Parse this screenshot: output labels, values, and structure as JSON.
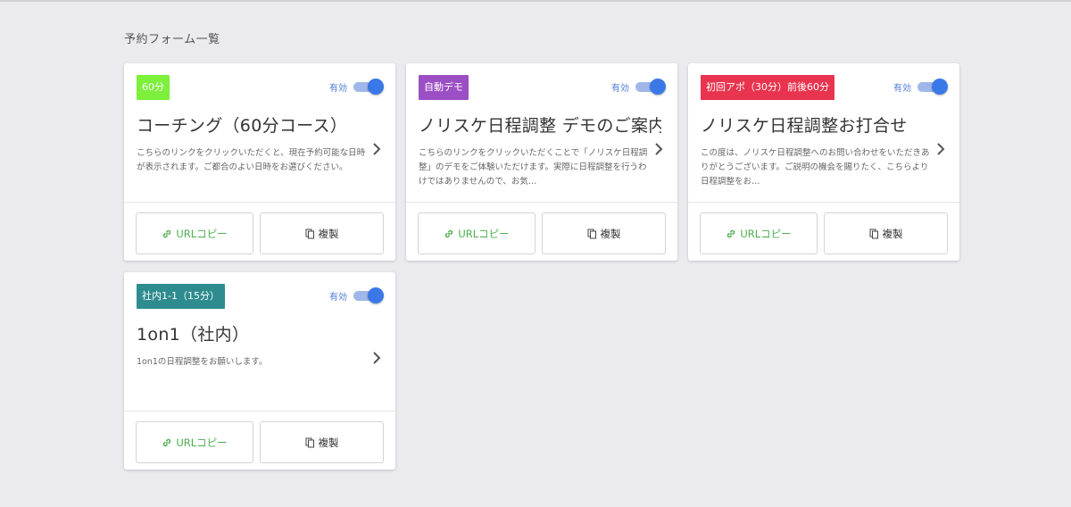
{
  "page": {
    "title": "予約フォーム一覧"
  },
  "common": {
    "toggle_label": "有効",
    "url_copy_label": "URLコピー",
    "duplicate_label": "複製",
    "url_color": "#4caf50",
    "toggle_color": "#3b78e7"
  },
  "cards": [
    {
      "badge": "60分",
      "badge_color": "#7cf03a",
      "title": "コーチング（60分コース）",
      "description": "こちらのリンクをクリックいただくと、現在予約可能な日時が表示されます。ご都合のよい日時をお選びください。",
      "enabled": true
    },
    {
      "badge": "自動デモ",
      "badge_color": "#9b4fc4",
      "title": "ノリスケ日程調整 デモのご案内",
      "description": "こちらのリンクをクリックいただくことで「ノリスケ日程調整」のデモをご体験いただけます。実際に日程調整を行うわけではありませんので、お気…",
      "enabled": true
    },
    {
      "badge": "初回アポ（30分）前後60分",
      "badge_color": "#e8344e",
      "title": "ノリスケ日程調整お打合せ",
      "description": "この度は、ノリスケ日程調整へのお問い合わせをいただきありがとうございます。ご説明の機会を賜りたく、こちらより日程調整をお…",
      "enabled": true
    },
    {
      "badge": "社内1-1（15分）",
      "badge_color": "#2e8c8f",
      "title": "1on1（社内）",
      "description": "1on1の日程調整をお願いします。",
      "enabled": true
    }
  ]
}
